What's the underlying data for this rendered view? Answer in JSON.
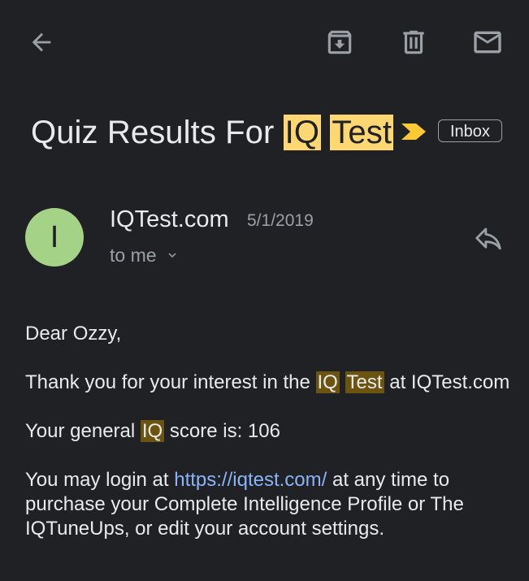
{
  "toolbar": {
    "back_icon": "arrow-back-icon",
    "archive_icon": "archive-icon",
    "delete_icon": "trash-icon",
    "mark_unread_icon": "mail-icon"
  },
  "subject": {
    "part1": "Quiz Results For ",
    "hl1": "IQ",
    "space": " ",
    "hl2": "Test",
    "label_chip": "Inbox",
    "importance_color": "#fcc934"
  },
  "message": {
    "avatar_letter": "I",
    "avatar_color": "#a4d387",
    "sender": "IQTest.com",
    "date": "5/1/2019",
    "recipient": "to me",
    "reply_icon": "reply-icon"
  },
  "body": {
    "greeting": "Dear Ozzy,",
    "p1_before": "Thank you for your interest in the ",
    "p1_hl1": "IQ",
    "p1_hl2": "Test",
    "p1_after": " at IQTest.com",
    "p2_before": "Your general ",
    "p2_hl": "IQ",
    "p2_after": " score is: 106",
    "p3_before": "You may login at ",
    "p3_link": "https://iqtest.com/",
    "p3_after_line1": " at any time to",
    "p3_line2": "purchase your Complete Intelligence Profile or The",
    "p3_line3": "IQTuneUps, or edit your account settings."
  }
}
